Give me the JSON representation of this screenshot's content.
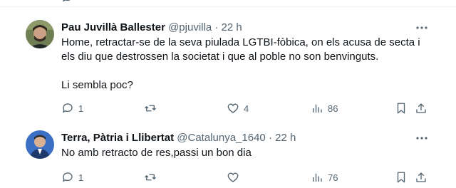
{
  "icons": {
    "reply": "reply-icon",
    "retweet": "retweet-icon",
    "like": "heart-icon",
    "views": "views-chart-icon",
    "bookmark": "bookmark-icon",
    "share": "share-icon",
    "more": "more-dots-icon"
  },
  "colors": {
    "text": "#0f1419",
    "secondary": "#536471",
    "divider": "#eff3f4"
  },
  "tweets": [
    {
      "author_name": "Pau Juvillà Ballester",
      "handle": "@pjuvilla",
      "separator": "·",
      "time": "22 h",
      "body_lines": [
        "Home, retractar-se de la seva piulada LGTBI-fòbica, on els acusa de secta i",
        "els diu que destrossen la societat i que al poble no son benvinguts."
      ],
      "body_extra": "Li sembla poc?",
      "reply_count": "1",
      "retweet_count": "",
      "like_count": "4",
      "view_count": "86"
    },
    {
      "author_name": "Terra, Pàtria i Llibertat",
      "handle": "@Catalunya_1640",
      "separator": "·",
      "time": "22 h",
      "body_lines": [
        "No amb retracto de res,passi un bon dia"
      ],
      "body_extra": "",
      "reply_count": "1",
      "retweet_count": "",
      "like_count": "",
      "view_count": "76"
    }
  ]
}
